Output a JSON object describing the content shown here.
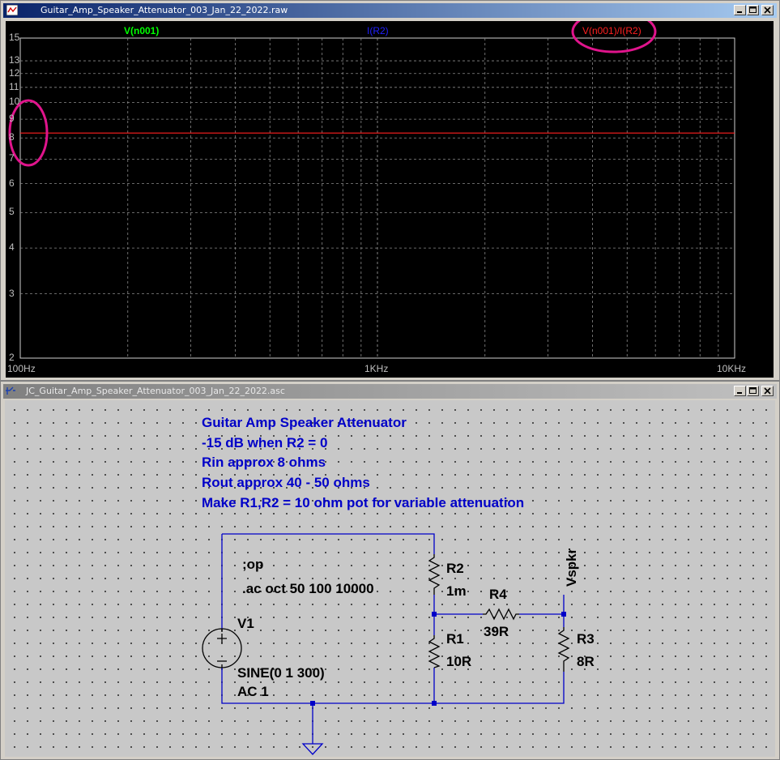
{
  "waveform_window": {
    "title": "Guitar_Amp_Speaker_Attenuator_003_Jan_22_2022.raw",
    "icon": "waveform-icon",
    "traces": [
      {
        "name": "V(n001)",
        "color": "#00ff00"
      },
      {
        "name": "I(R2)",
        "color": "#2020ff"
      },
      {
        "name": "V(n001)/I(R2)",
        "color": "#ff2020"
      }
    ],
    "y_ticks": [
      "15",
      "13",
      "12",
      "11",
      "10",
      "9",
      "8",
      "7",
      "6",
      "5",
      "4",
      "3",
      "2"
    ],
    "x_ticks": [
      "100Hz",
      "1KHz",
      "10KHz"
    ],
    "annotation_color": "#e0148c",
    "chart_data": {
      "type": "line",
      "title": "",
      "xlabel": "",
      "ylabel": "",
      "x_scale": "log",
      "y_scale": "log",
      "xlim": [
        100,
        10000
      ],
      "ylim": [
        2,
        15
      ],
      "grid": true,
      "series": [
        {
          "name": "V(n001)/I(R2)",
          "x": [
            100,
            10000
          ],
          "values": [
            8.25,
            8.25
          ],
          "color": "#ff2020"
        }
      ]
    }
  },
  "schematic_window": {
    "title": "JC_Guitar_Amp_Speaker_Attenuator_003_Jan_22_2022.asc",
    "icon": "schematic-icon",
    "notes": [
      "Guitar Amp Speaker Attenuator",
      "-15 dB when R2 = 0",
      "Rin approx 8 ohms",
      "Rout approx 40 - 50 ohms",
      "Make R1,R2 = 10 ohm pot for variable attenuation"
    ],
    "directives": [
      ";op",
      ".ac oct 50 100 10000"
    ],
    "components": {
      "V1": {
        "name": "V1",
        "value1": "SINE(0 1 300)",
        "value2": "AC 1"
      },
      "R1": {
        "name": "R1",
        "value": "10R"
      },
      "R2": {
        "name": "R2",
        "value": "1m"
      },
      "R3": {
        "name": "R3",
        "value": "8R"
      },
      "R4": {
        "name": "R4",
        "value": "39R"
      }
    },
    "net_label": "Vspkr",
    "wire_color": "#0000c8"
  }
}
